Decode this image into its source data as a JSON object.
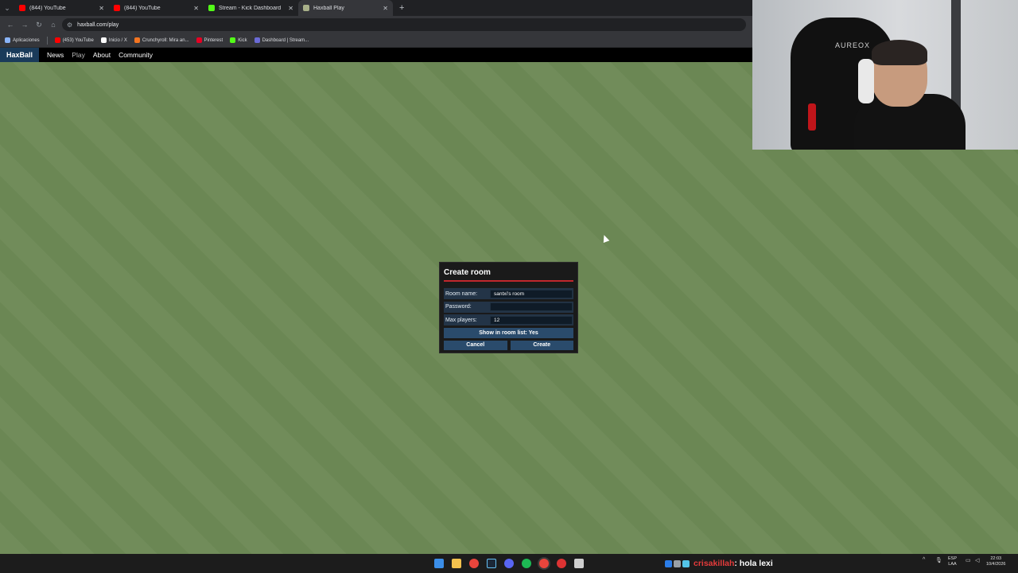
{
  "browser": {
    "tabs": [
      {
        "label": "(844) YouTube",
        "color": "#ff0000",
        "active": false
      },
      {
        "label": "(844) YouTube",
        "color": "#ff0000",
        "active": false
      },
      {
        "label": "Stream - Kick Dashboard",
        "color": "#53fc18",
        "active": false
      },
      {
        "label": "Haxball Play",
        "color": "#a8b089",
        "active": true
      }
    ],
    "url": "haxball.com/play",
    "bookmarks": [
      {
        "label": "Aplicaciones",
        "color": "#8ab4f8"
      },
      {
        "label": "(453) YouTube",
        "color": "#ff0000"
      },
      {
        "label": "Inicio / X",
        "color": "#ffffff"
      },
      {
        "label": "Crunchyroll: Mira an...",
        "color": "#f47521"
      },
      {
        "label": "Pinterest",
        "color": "#e60023"
      },
      {
        "label": "Kick",
        "color": "#53fc18"
      },
      {
        "label": "Dashboard | Stream...",
        "color": "#6b6bd6"
      }
    ]
  },
  "haxball_nav": {
    "logo": "HaxBall",
    "links": [
      {
        "label": "News",
        "color": "#ffffff"
      },
      {
        "label": "Play",
        "color": "#b8b8b8"
      },
      {
        "label": "About",
        "color": "#ffffff"
      },
      {
        "label": "Community",
        "color": "#ffffff"
      }
    ]
  },
  "webcam": {
    "chair_brand": "AUREOX"
  },
  "dialog": {
    "title": "Create room",
    "room_name_label": "Room name:",
    "room_name_value": "santxi's room",
    "password_label": "Password:",
    "password_value": "",
    "max_players_label": "Max players:",
    "max_players_value": "12",
    "room_list_toggle": "Show in room list: Yes",
    "cancel_label": "Cancel",
    "create_label": "Create"
  },
  "taskbar": {
    "chat_user": "crisakillah",
    "chat_message": ": hola lexi",
    "language": "ESP",
    "language_sub": "LAA",
    "time": "22:03",
    "date": "10/4/2026"
  }
}
